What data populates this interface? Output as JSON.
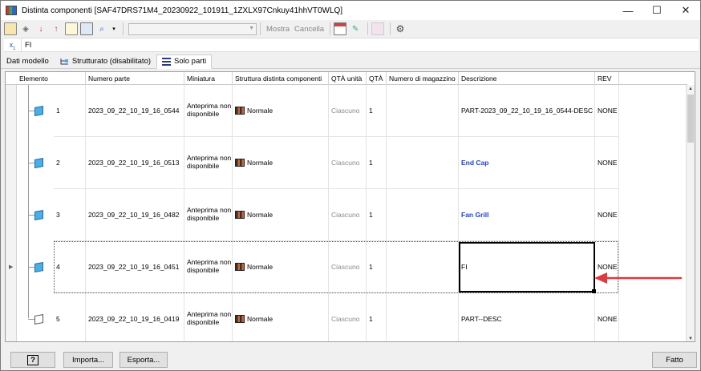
{
  "window": {
    "title": "Distinta componenti [SAF47DRS71M4_20230922_101911_1ZXLX97Cnkuy41hhVT0WLQ]",
    "controls": {
      "minimize": "—",
      "maximize": "☐",
      "close": "✕"
    }
  },
  "toolbar": {
    "mostra_label": "Mostra",
    "cancella_label": "Cancella",
    "combo_value": ""
  },
  "formula_bar": {
    "value": "FI"
  },
  "tabs": [
    {
      "label": "Dati modello",
      "active": false
    },
    {
      "label": "Strutturato (disabilitato)",
      "active": false
    },
    {
      "label": "Solo parti",
      "active": true
    }
  ],
  "grid": {
    "columns": [
      "Elemento",
      "Numero parte",
      "Miniatura",
      "Struttura distinta componenti",
      "QTÀ unità",
      "QTÀ",
      "Numero di magazzino",
      "Descrizione",
      "REV"
    ],
    "rows": [
      {
        "item": "1",
        "part_number": "2023_09_22_10_19_16_0544",
        "thumbnail": "Anteprima non disponibile",
        "bom_structure": "Normale",
        "unit_qty": "Ciascuno",
        "qty": "1",
        "stock_number": "",
        "description": "PART-2023_09_22_10_19_16_0544-DESC",
        "description_bold": false,
        "rev": "NONE",
        "icon": "part-icon"
      },
      {
        "item": "2",
        "part_number": "2023_09_22_10_19_16_0513",
        "thumbnail": "Anteprima non disponibile",
        "bom_structure": "Normale",
        "unit_qty": "Ciascuno",
        "qty": "1",
        "stock_number": "",
        "description": "End Cap",
        "description_bold": true,
        "rev": "NONE",
        "icon": "part-icon"
      },
      {
        "item": "3",
        "part_number": "2023_09_22_10_19_16_0482",
        "thumbnail": "Anteprima non disponibile",
        "bom_structure": "Normale",
        "unit_qty": "Ciascuno",
        "qty": "1",
        "stock_number": "",
        "description": "Fan Grill",
        "description_bold": true,
        "rev": "NONE",
        "icon": "part-icon"
      },
      {
        "item": "4",
        "part_number": "2023_09_22_10_19_16_0451",
        "thumbnail": "Anteprima non disponibile",
        "bom_structure": "Normale",
        "unit_qty": "Ciascuno",
        "qty": "1",
        "stock_number": "",
        "description": "FI",
        "description_bold": false,
        "rev": "NONE",
        "icon": "part-icon"
      },
      {
        "item": "5",
        "part_number": "2023_09_22_10_19_16_0419",
        "thumbnail": "Anteprima non disponibile",
        "bom_structure": "Normale",
        "unit_qty": "Ciascuno",
        "qty": "1",
        "stock_number": "",
        "description": "PART--DESC",
        "description_bold": false,
        "rev": "NONE",
        "icon": "document-part-icon"
      }
    ]
  },
  "footer": {
    "help_label": "?",
    "import_label": "Importa...",
    "export_label": "Esporta...",
    "done_label": "Fatto"
  },
  "colors": {
    "bold_description": "#1f3fcf",
    "annotation_arrow": "#e0393e"
  }
}
